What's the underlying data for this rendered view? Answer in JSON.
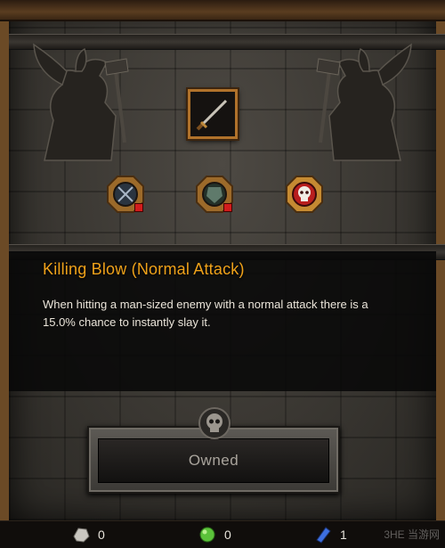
{
  "skill": {
    "title": "Killing Blow (Normal Attack)",
    "description": "When hitting a man-sized enemy with a normal attack there is a 15.0% chance to instantly slay it."
  },
  "actions": {
    "owned_label": "Owned"
  },
  "icons": {
    "main": "sword-icon",
    "sub": [
      "crossed-swords-icon",
      "armor-icon",
      "skull-icon"
    ]
  },
  "resources": [
    {
      "icon": "silver-ore-icon",
      "value": "0"
    },
    {
      "icon": "green-gem-icon",
      "value": "0"
    },
    {
      "icon": "blue-crystal-icon",
      "value": "1"
    }
  ],
  "watermark": "3HE 当游网",
  "colors": {
    "title": "#f0a21a",
    "frame": "#6b4a26",
    "badge": "#d21c1c"
  }
}
